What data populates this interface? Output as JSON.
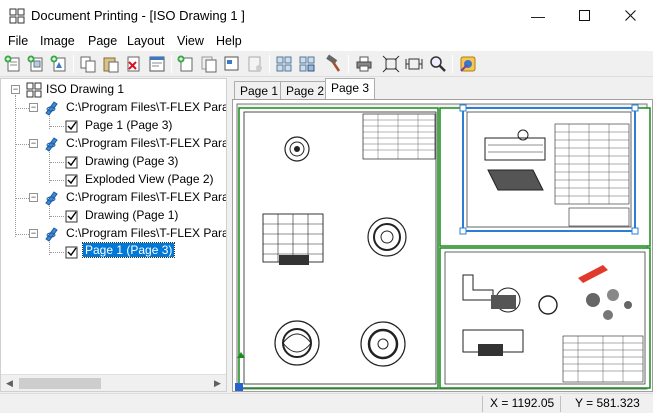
{
  "window": {
    "title": "Document Printing - [ISO Drawing 1 ]"
  },
  "menu": [
    "File",
    "Image",
    "Page",
    "Layout",
    "View",
    "Help"
  ],
  "toolbar_icons": [
    "add-sheet-icon",
    "add-copy-icon",
    "add-page-icon",
    "copy-icon",
    "paste-icon",
    "delete-icon",
    "properties-icon",
    "new-page-icon",
    "duplicate-page-icon",
    "page-settings-icon",
    "page-delete-icon",
    "grid-layout-icon",
    "grid-layout-2-icon",
    "hammer-icon",
    "printer-icon",
    "fit-page-icon",
    "fit-width-icon",
    "zoom-icon",
    "settings-wizard-icon"
  ],
  "tree": {
    "root": "ISO Drawing 1",
    "items": [
      {
        "kind": "doc",
        "label": "C:\\Program Files\\T-FLEX Parar"
      },
      {
        "kind": "page",
        "label": "Page 1 (Page 3)"
      },
      {
        "kind": "doc",
        "label": "C:\\Program Files\\T-FLEX Parar"
      },
      {
        "kind": "page",
        "label": "Drawing (Page 3)"
      },
      {
        "kind": "page",
        "label": "Exploded View (Page 2)"
      },
      {
        "kind": "doc",
        "label": "C:\\Program Files\\T-FLEX Parar"
      },
      {
        "kind": "page",
        "label": "Drawing (Page 1)"
      },
      {
        "kind": "doc",
        "label": "C:\\Program Files\\T-FLEX Parar"
      },
      {
        "kind": "page",
        "label": "Page 1 (Page 3)",
        "selected": true
      }
    ]
  },
  "tabs": [
    {
      "label": "Page 1",
      "active": false
    },
    {
      "label": "Page 2",
      "active": false
    },
    {
      "label": "Page 3",
      "active": true
    }
  ],
  "status": {
    "x": "X = 1192.05",
    "y": "Y = 581.323"
  },
  "colors": {
    "selection": "#0078d7",
    "sheet_border_green": "#1a8c1a",
    "sheet_selected_blue": "#2a7fd4"
  }
}
